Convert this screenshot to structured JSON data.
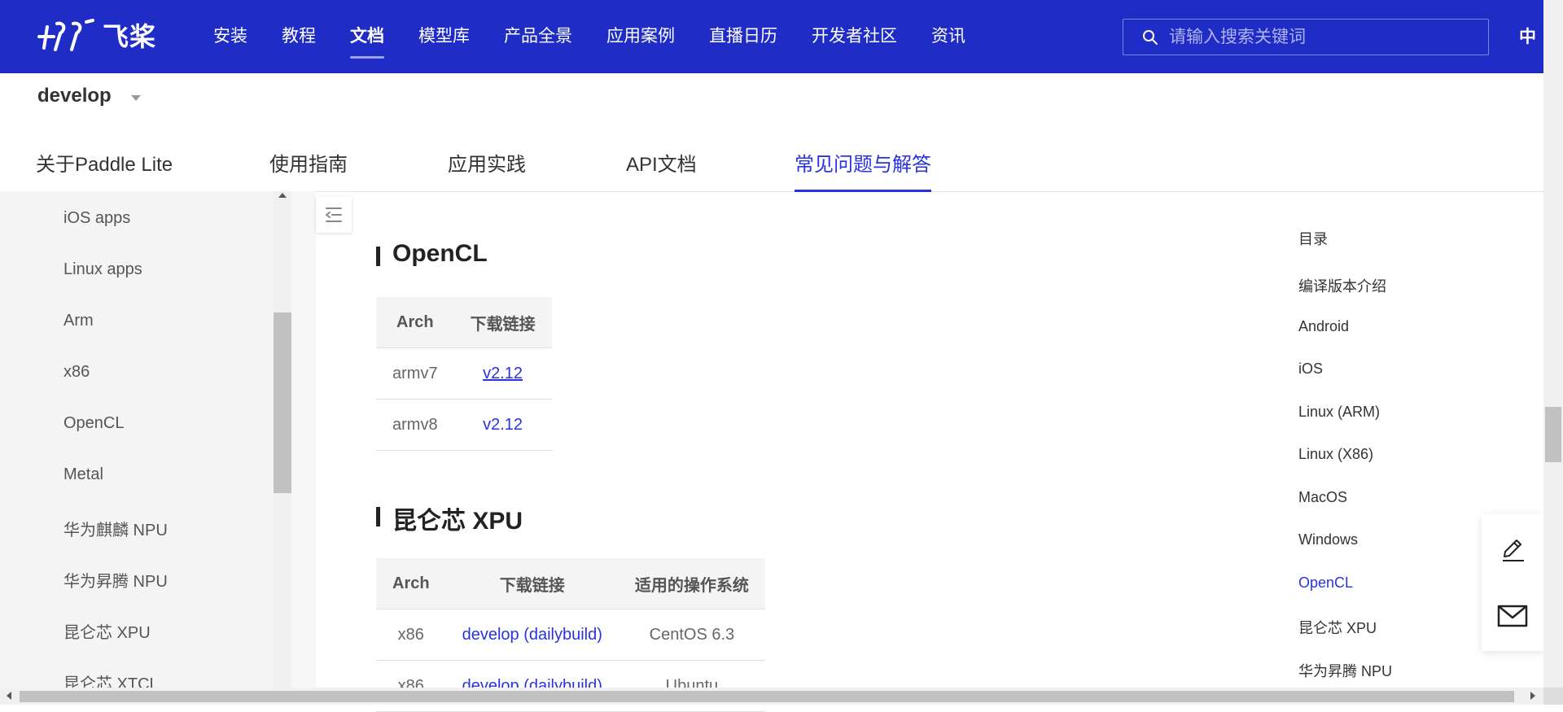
{
  "brand": {
    "logo_text": "飞桨"
  },
  "topnav": {
    "items": [
      "安装",
      "教程",
      "文档",
      "模型库",
      "产品全景",
      "应用案例",
      "直播日历",
      "开发者社区",
      "资讯"
    ],
    "active": "文档",
    "search_placeholder": "请输入搜索关键词",
    "lang": "中"
  },
  "version": {
    "label": "develop"
  },
  "doc_tabs": {
    "items": [
      "关于Paddle Lite",
      "使用指南",
      "应用实践",
      "API文档",
      "常见问题与解答"
    ],
    "active": "常见问题与解答"
  },
  "sidebar": {
    "items": [
      "iOS apps",
      "Linux apps",
      "Arm",
      "x86",
      "OpenCL",
      "Metal",
      "华为麒麟 NPU",
      "华为昇腾 NPU",
      "昆仑芯 XPU",
      "昆仑芯 XTCL"
    ]
  },
  "main": {
    "opencl": {
      "title": "OpenCL",
      "headers": [
        "Arch",
        "下载链接"
      ],
      "rows": [
        {
          "arch": "armv7",
          "link": "v2.12"
        },
        {
          "arch": "armv8",
          "link": "v2.12"
        }
      ]
    },
    "xpu": {
      "title": "昆仑芯 XPU",
      "headers": [
        "Arch",
        "下载链接",
        "适用的操作系统"
      ],
      "rows": [
        {
          "arch": "x86",
          "link": "develop (dailybuild)",
          "os": "CentOS 6.3"
        },
        {
          "arch": "x86",
          "link": "develop (dailybuild)",
          "os": "Ubuntu"
        }
      ]
    }
  },
  "toc": {
    "title": "目录",
    "items": [
      "编译版本介绍",
      "Android",
      "iOS",
      "Linux (ARM)",
      "Linux (X86)",
      "MacOS",
      "Windows",
      "OpenCL",
      "昆仑芯 XPU",
      "华为昇腾 NPU"
    ],
    "active": "OpenCL"
  },
  "colors": {
    "nav_bg": "#1f2cc6",
    "accent": "#2932e1",
    "sidebar_bg": "#f4f4f4"
  },
  "icons": {
    "search": "search-icon",
    "edit": "pencil-icon",
    "mail": "mail-icon",
    "collapse": "collapse-sidebar-icon"
  }
}
